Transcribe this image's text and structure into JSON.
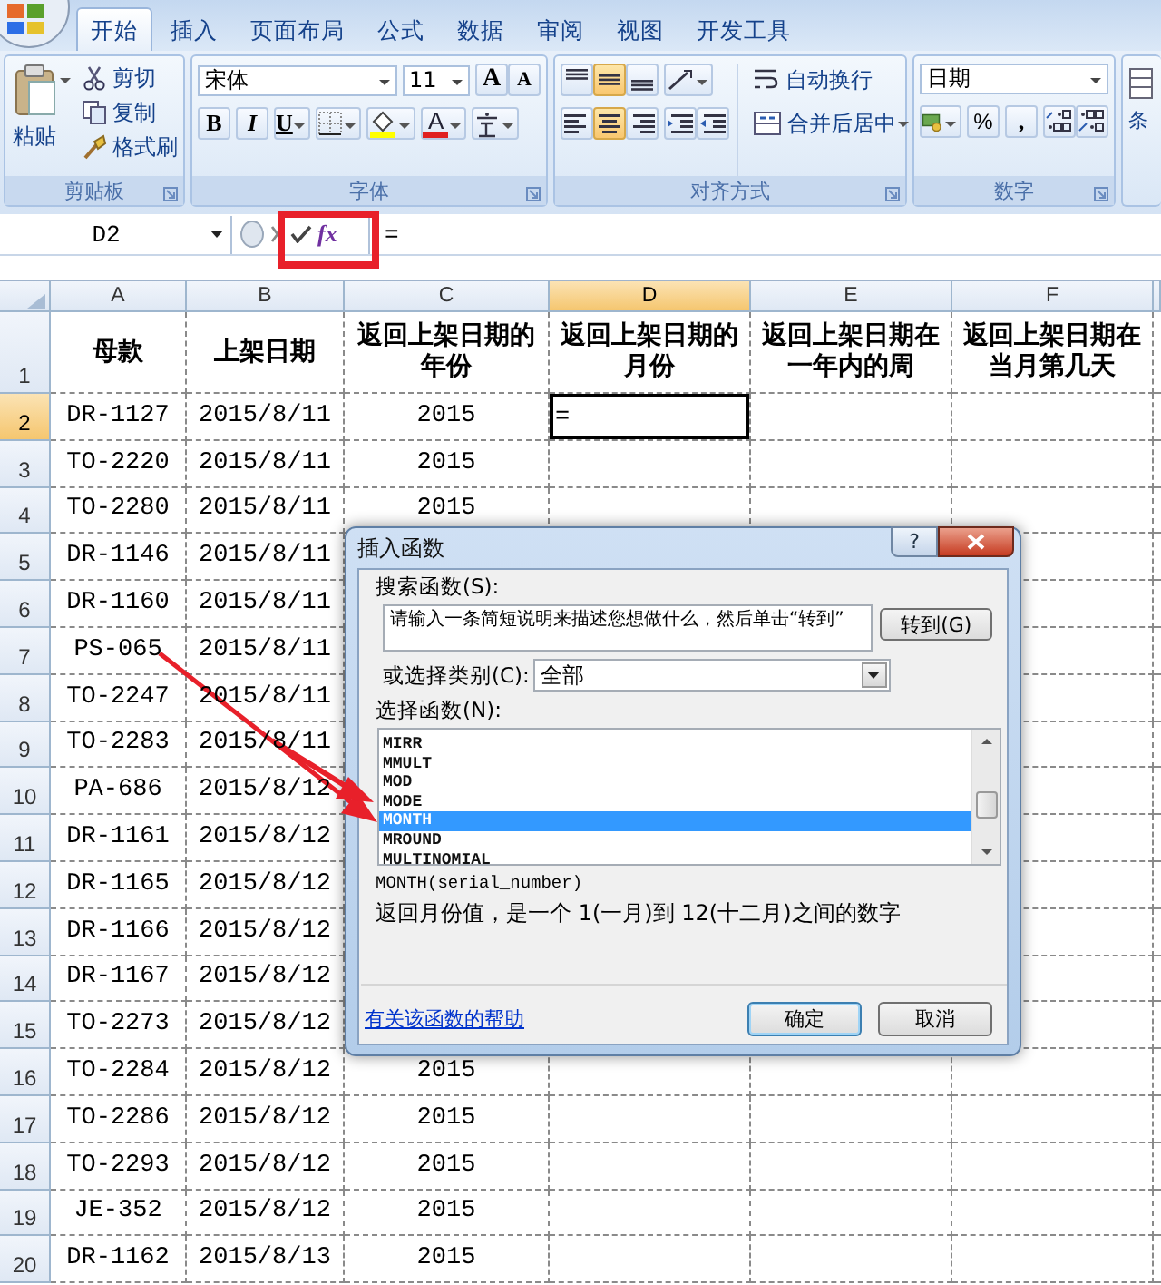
{
  "ribbon": {
    "tabs": [
      {
        "label": "开始",
        "selected": true
      },
      {
        "label": "插入",
        "selected": false
      },
      {
        "label": "页面布局",
        "selected": false
      },
      {
        "label": "公式",
        "selected": false
      },
      {
        "label": "数据",
        "selected": false
      },
      {
        "label": "审阅",
        "selected": false
      },
      {
        "label": "视图",
        "selected": false
      },
      {
        "label": "开发工具",
        "selected": false
      }
    ],
    "clipboard": {
      "paste": "粘贴",
      "cut": "剪切",
      "copy": "复制",
      "format_painter": "格式刷",
      "label": "剪贴板"
    },
    "font": {
      "name": "宋体",
      "size": "11",
      "grow": "A",
      "shrink": "A",
      "bold": "B",
      "italic": "I",
      "underline": "U",
      "font_color": "A",
      "label": "字体"
    },
    "alignment": {
      "vertical": [
        {
          "selected": false
        },
        {
          "selected": true
        },
        {
          "selected": false
        }
      ],
      "horizontal": [
        {
          "selected": false
        },
        {
          "selected": true
        },
        {
          "selected": false
        }
      ],
      "wrap": "自动换行",
      "merge": "合并后居中",
      "label": "对齐方式"
    },
    "number": {
      "format": "日期",
      "percent": "%",
      "comma": ",",
      "label": "数字"
    },
    "styles_partial": "条"
  },
  "formula_bar": {
    "name_box": "D2",
    "function_button": "fx",
    "formula": "="
  },
  "sheet": {
    "columns": [
      {
        "label": "A",
        "selected": false
      },
      {
        "label": "B",
        "selected": false
      },
      {
        "label": "C",
        "selected": false
      },
      {
        "label": "D",
        "selected": true
      },
      {
        "label": "E",
        "selected": false
      },
      {
        "label": "F",
        "selected": false
      }
    ],
    "rows": [
      {
        "number": "1",
        "selected": false,
        "kind": "header",
        "cells": [
          "母款",
          "上架日期",
          "返回上架日期的年份",
          "返回上架日期的月份",
          "返回上架日期在一年内的周",
          "返回上架日期在当月第几天"
        ]
      },
      {
        "number": "2",
        "selected": true,
        "kind": "data",
        "cells": [
          "DR-1127",
          "2015/8/11",
          "2015",
          "="
        ]
      },
      {
        "number": "3",
        "selected": false,
        "kind": "data",
        "cells": [
          "TO-2220",
          "2015/8/11",
          "2015"
        ]
      },
      {
        "number": "4",
        "selected": false,
        "kind": "data",
        "cells": [
          "TO-2280",
          "2015/8/11",
          "2015"
        ]
      },
      {
        "number": "5",
        "selected": false,
        "kind": "data",
        "cells": [
          "DR-1146",
          "2015/8/11"
        ]
      },
      {
        "number": "6",
        "selected": false,
        "kind": "data",
        "cells": [
          "DR-1160",
          "2015/8/11"
        ]
      },
      {
        "number": "7",
        "selected": false,
        "kind": "data",
        "cells": [
          "PS-065",
          "2015/8/11"
        ]
      },
      {
        "number": "8",
        "selected": false,
        "kind": "data",
        "cells": [
          "TO-2247",
          "2015/8/11"
        ]
      },
      {
        "number": "9",
        "selected": false,
        "kind": "data",
        "cells": [
          "TO-2283",
          "2015/8/11"
        ]
      },
      {
        "number": "10",
        "selected": false,
        "kind": "data",
        "cells": [
          "PA-686",
          "2015/8/12"
        ]
      },
      {
        "number": "11",
        "selected": false,
        "kind": "data",
        "cells": [
          "DR-1161",
          "2015/8/12"
        ]
      },
      {
        "number": "12",
        "selected": false,
        "kind": "data",
        "cells": [
          "DR-1165",
          "2015/8/12"
        ]
      },
      {
        "number": "13",
        "selected": false,
        "kind": "data",
        "cells": [
          "DR-1166",
          "2015/8/12"
        ]
      },
      {
        "number": "14",
        "selected": false,
        "kind": "data",
        "cells": [
          "DR-1167",
          "2015/8/12"
        ]
      },
      {
        "number": "15",
        "selected": false,
        "kind": "data",
        "cells": [
          "TO-2273",
          "2015/8/12"
        ]
      },
      {
        "number": "16",
        "selected": false,
        "kind": "data",
        "cells": [
          "TO-2284",
          "2015/8/12",
          "2015"
        ]
      },
      {
        "number": "17",
        "selected": false,
        "kind": "data",
        "cells": [
          "TO-2286",
          "2015/8/12",
          "2015"
        ]
      },
      {
        "number": "18",
        "selected": false,
        "kind": "data",
        "cells": [
          "TO-2293",
          "2015/8/12",
          "2015"
        ]
      },
      {
        "number": "19",
        "selected": false,
        "kind": "data",
        "cells": [
          "JE-352",
          "2015/8/12",
          "2015"
        ]
      },
      {
        "number": "20",
        "selected": false,
        "kind": "data",
        "cells": [
          "DR-1162",
          "2015/8/13",
          "2015"
        ]
      }
    ]
  },
  "dialog": {
    "title": "插入函数",
    "help_button": "?",
    "search_label": "搜索函数(S):",
    "search_value": "请输入一条简短说明来描述您想做什么，然后单击“转到”",
    "go_button": "转到(G)",
    "category_label": "或选择类别(C):",
    "category": "全部",
    "function_label": "选择函数(N):",
    "functions": [
      {
        "name": "MIRR",
        "selected": false
      },
      {
        "name": "MMULT",
        "selected": false
      },
      {
        "name": "MOD",
        "selected": false
      },
      {
        "name": "MODE",
        "selected": false
      },
      {
        "name": "MONTH",
        "selected": true
      },
      {
        "name": "MROUND",
        "selected": false
      },
      {
        "name": "MULTINOMIAL",
        "selected": false
      }
    ],
    "signature": "MONTH(serial_number)",
    "description": "返回月份值，是一个 1(一月)到 12(十二月)之间的数字",
    "help_link": "有关该函数的帮助",
    "ok_button": "确定",
    "cancel_button": "取消"
  }
}
